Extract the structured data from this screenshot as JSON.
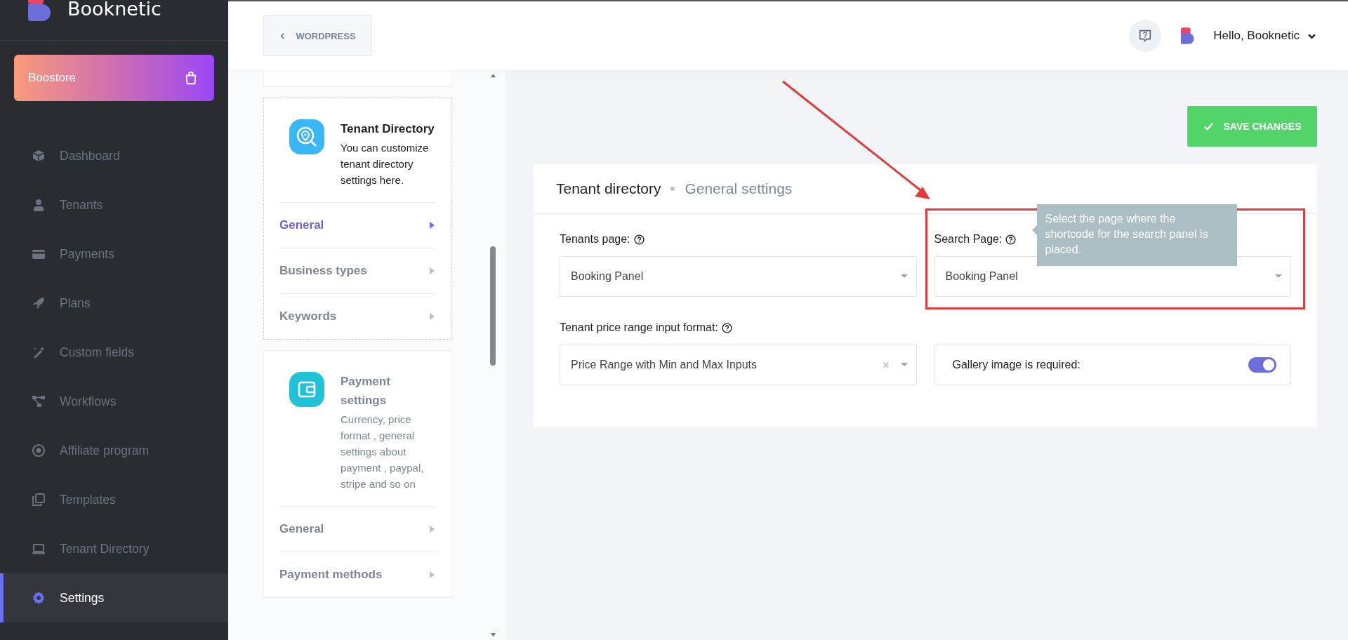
{
  "sidebar": {
    "logo": "Booknetic",
    "boostore": "Boostore",
    "items": [
      {
        "label": "Dashboard",
        "selected": false
      },
      {
        "label": "Tenants",
        "selected": false
      },
      {
        "label": "Payments",
        "selected": false
      },
      {
        "label": "Plans",
        "selected": false
      },
      {
        "label": "Custom fields",
        "selected": false
      },
      {
        "label": "Workflows",
        "selected": false
      },
      {
        "label": "Affiliate program",
        "selected": false
      },
      {
        "label": "Templates",
        "selected": false
      },
      {
        "label": "Tenant Directory",
        "selected": false
      },
      {
        "label": "Settings",
        "selected": true
      }
    ]
  },
  "header": {
    "back_button": "WORDPRESS",
    "greeting": "Hello, Booknetic"
  },
  "settings_menu": {
    "sections": [
      {
        "title": "Tenant Directory",
        "description": "You can customize tenant directory settings here.",
        "selected": true,
        "links": [
          {
            "label": "General",
            "selected": true
          },
          {
            "label": "Business types",
            "selected": false
          },
          {
            "label": "Keywords",
            "selected": false
          }
        ]
      },
      {
        "title": "Payment settings",
        "description": "Currency, price format , general settings about payment , paypal, stripe and so on",
        "selected": false,
        "links": [
          {
            "label": "General",
            "selected": false
          },
          {
            "label": "Payment methods",
            "selected": false
          }
        ]
      }
    ]
  },
  "save_button": "SAVE CHANGES",
  "card": {
    "title": "Tenant directory",
    "subtitle": "General settings",
    "fields": [
      {
        "kind": "select",
        "label": "Tenants page:",
        "value": "Booking Panel",
        "clearable": false,
        "highlighted": false
      },
      {
        "kind": "select",
        "label": "Search Page:",
        "value": "Booking Panel",
        "clearable": false,
        "highlighted": true,
        "tooltip": "Select the page where the shortcode for the search panel is placed."
      },
      {
        "kind": "select",
        "label": "Tenant price range input format:",
        "value": "Price Range with Min and Max Inputs",
        "clearable": true,
        "highlighted": false
      },
      {
        "kind": "toggle",
        "label": "Gallery image is required:",
        "on": true
      }
    ]
  }
}
